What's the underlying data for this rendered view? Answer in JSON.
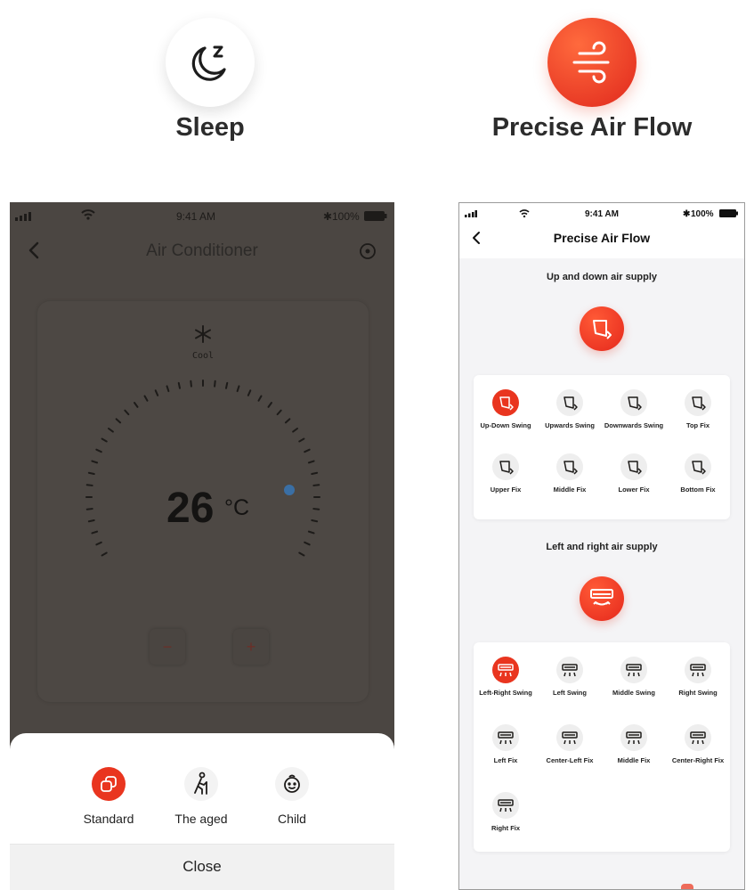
{
  "features": {
    "sleep": {
      "label": "Sleep",
      "icon": "moon-z-icon"
    },
    "airflow": {
      "label": "Precise Air Flow",
      "icon": "wind-icon",
      "color": "#e9351f"
    }
  },
  "left_phone": {
    "status": {
      "time": "9:41 AM",
      "battery": "100%"
    },
    "title": "Air Conditioner",
    "mode": {
      "icon": "snowflake-icon",
      "label": "Cool"
    },
    "temperature": {
      "value": "26",
      "unit": "°C"
    },
    "controls": {
      "minus": "−",
      "plus": "+"
    },
    "sleep_modes": [
      {
        "label": "Standard",
        "icon": "standard-mode-icon",
        "selected": true
      },
      {
        "label": "The aged",
        "icon": "elder-icon",
        "selected": false
      },
      {
        "label": "Child",
        "icon": "child-icon",
        "selected": false
      }
    ],
    "close_label": "Close"
  },
  "right_phone": {
    "status": {
      "time": "9:41 AM",
      "battery": "100%"
    },
    "title": "Precise Air Flow",
    "up_down": {
      "title": "Up and down air supply",
      "options": [
        {
          "label": "Up-Down Swing",
          "selected": true
        },
        {
          "label": "Upwards Swing",
          "selected": false
        },
        {
          "label": "Downwards Swing",
          "selected": false
        },
        {
          "label": "Top Fix",
          "selected": false
        },
        {
          "label": "Upper Fix",
          "selected": false
        },
        {
          "label": "Middle Fix",
          "selected": false
        },
        {
          "label": "Lower Fix",
          "selected": false
        },
        {
          "label": "Bottom Fix",
          "selected": false
        }
      ]
    },
    "left_right": {
      "title": "Left and right air supply",
      "options": [
        {
          "label": "Left-Right Swing",
          "selected": true
        },
        {
          "label": "Left Swing",
          "selected": false
        },
        {
          "label": "Middle Swing",
          "selected": false
        },
        {
          "label": "Right Swing",
          "selected": false
        },
        {
          "label": "Left Fix",
          "selected": false
        },
        {
          "label": "Center-Left Fix",
          "selected": false
        },
        {
          "label": "Middle Fix",
          "selected": false
        },
        {
          "label": "Center-Right Fix",
          "selected": false
        },
        {
          "label": "Right Fix",
          "selected": false
        }
      ]
    }
  }
}
